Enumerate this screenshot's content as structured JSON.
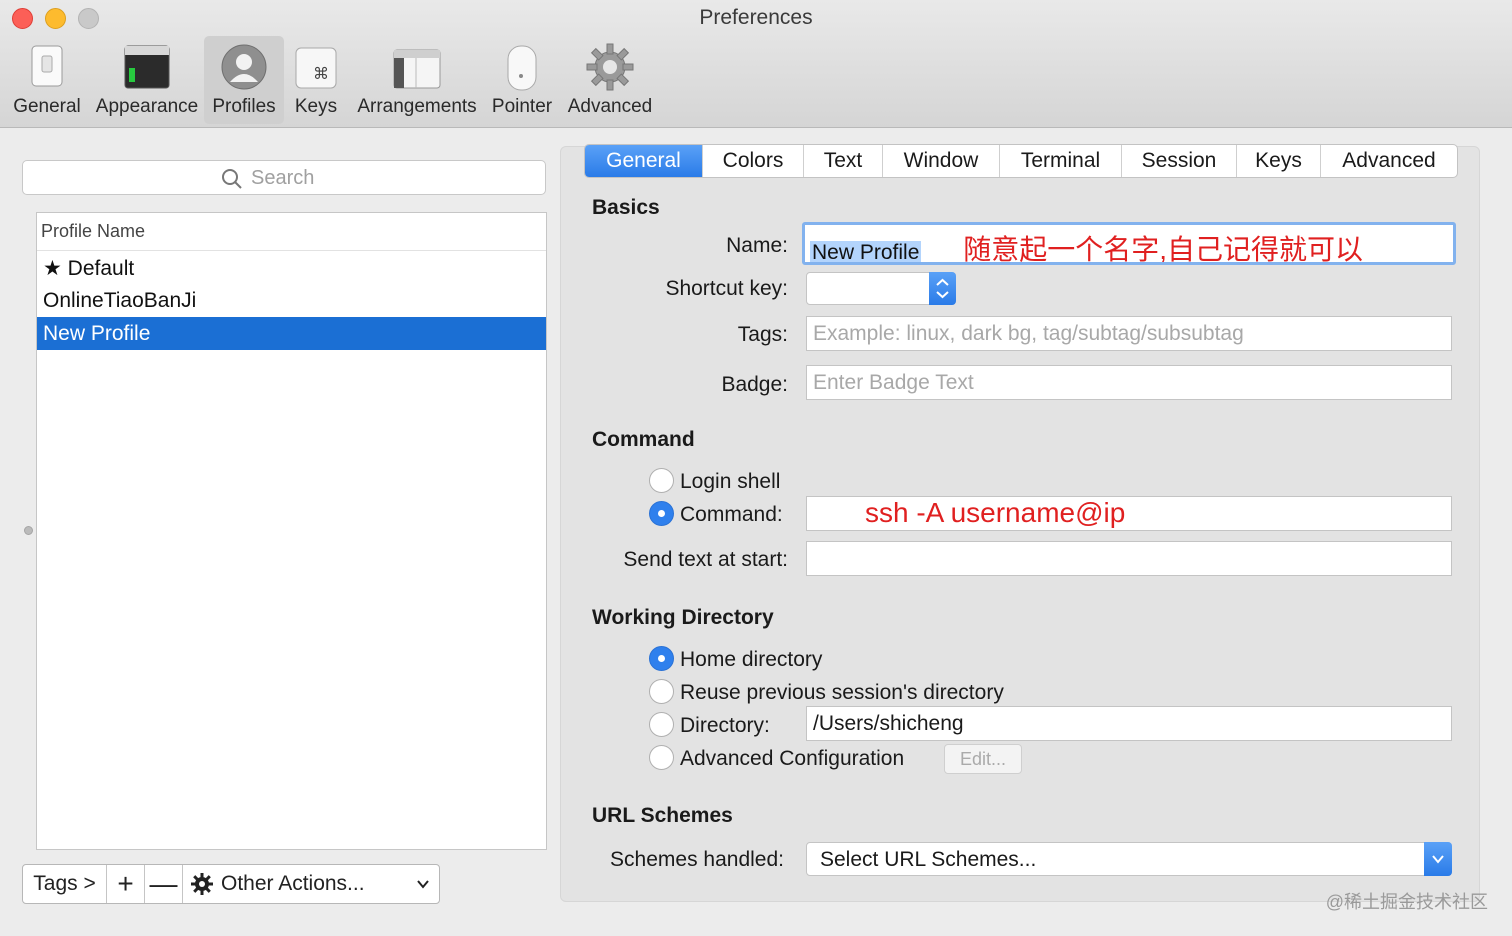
{
  "window": {
    "title": "Preferences"
  },
  "toolbar": {
    "items": [
      {
        "label": "General",
        "icon": "general-switch-icon"
      },
      {
        "label": "Appearance",
        "icon": "appearance-terminal-icon"
      },
      {
        "label": "Profiles",
        "icon": "profiles-person-icon",
        "selected": true
      },
      {
        "label": "Keys",
        "icon": "keys-command-icon"
      },
      {
        "label": "Arrangements",
        "icon": "arrangements-window-icon"
      },
      {
        "label": "Pointer",
        "icon": "pointer-mouse-icon"
      },
      {
        "label": "Advanced",
        "icon": "advanced-gear-icon"
      }
    ]
  },
  "left": {
    "search_placeholder": "Search",
    "column_header": "Profile Name",
    "profiles": [
      "★ Default",
      "OnlineTiaoBanJi",
      "New Profile"
    ],
    "selected_profile": "New Profile",
    "bottom": {
      "tags": "Tags >",
      "add": "+",
      "remove": "—",
      "other_actions": "Other Actions..."
    }
  },
  "tabs": [
    "General",
    "Colors",
    "Text",
    "Window",
    "Terminal",
    "Session",
    "Keys",
    "Advanced"
  ],
  "active_tab": "General",
  "basics": {
    "heading": "Basics",
    "name_label": "Name:",
    "name_value": "New Profile",
    "name_annotation": "随意起一个名字,自己记得就可以",
    "shortcut_label": "Shortcut key:",
    "tags_label": "Tags:",
    "tags_placeholder": "Example: linux, dark bg, tag/subtag/subsubtag",
    "badge_label": "Badge:",
    "badge_placeholder": "Enter Badge Text"
  },
  "command": {
    "heading": "Command",
    "login_shell": "Login shell",
    "command_label": "Command:",
    "command_value": "ssh -A username@ip",
    "send_text_label": "Send text at start:"
  },
  "working_directory": {
    "heading": "Working Directory",
    "home": "Home directory",
    "reuse": "Reuse previous session's directory",
    "directory_label": "Directory:",
    "directory_value": "/Users/shicheng",
    "advanced": "Advanced Configuration",
    "edit": "Edit..."
  },
  "url_schemes": {
    "heading": "URL Schemes",
    "label": "Schemes handled:",
    "value": "Select URL Schemes..."
  },
  "watermark": "@稀土掘金技术社区",
  "colors": {
    "accent": "#2a7be8",
    "annotation": "#e02020",
    "selection": "#1b6fd4"
  }
}
